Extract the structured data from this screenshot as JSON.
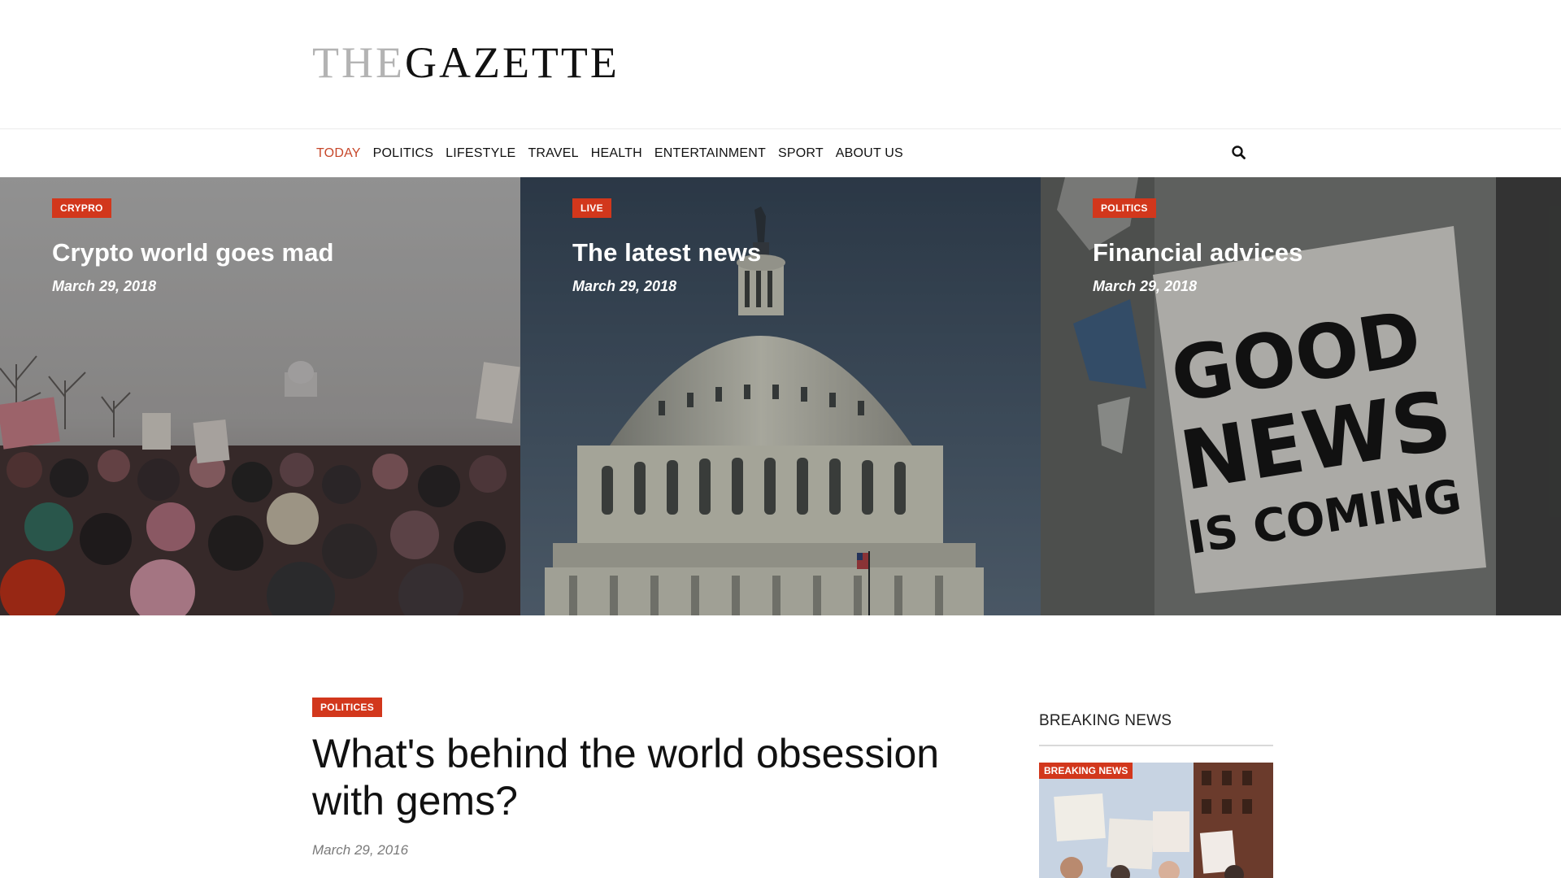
{
  "logo": {
    "prefix": "THE",
    "name": "GAZETTE"
  },
  "nav": {
    "items": [
      {
        "label": "TODAY",
        "active": true
      },
      {
        "label": "POLITICS"
      },
      {
        "label": "LIFESTYLE"
      },
      {
        "label": "TRAVEL"
      },
      {
        "label": "HEALTH"
      },
      {
        "label": "ENTERTAINMENT"
      },
      {
        "label": "SPORT"
      },
      {
        "label": "ABOUT US"
      }
    ],
    "search_icon": "search-icon"
  },
  "hero": [
    {
      "category": "CRYPRO",
      "title": "Crypto world goes mad",
      "date": "March 29, 2018"
    },
    {
      "category": "LIVE",
      "title": "The latest news",
      "date": "March 29, 2018"
    },
    {
      "category": "POLITICS",
      "title": "Financial advices",
      "date": "March 29, 2018",
      "poster_text": [
        "GOOD",
        "NEWS",
        "IS COMING"
      ]
    }
  ],
  "article": {
    "category": "POLITICES",
    "title": "What's behind the world obsession with gems?",
    "date": "March 29, 2016"
  },
  "sidebar": {
    "heading": "BREAKING NEWS",
    "card_badge": "BREAKING NEWS"
  },
  "colors": {
    "accent": "#d2371c",
    "nav_active": "#c7472a"
  }
}
